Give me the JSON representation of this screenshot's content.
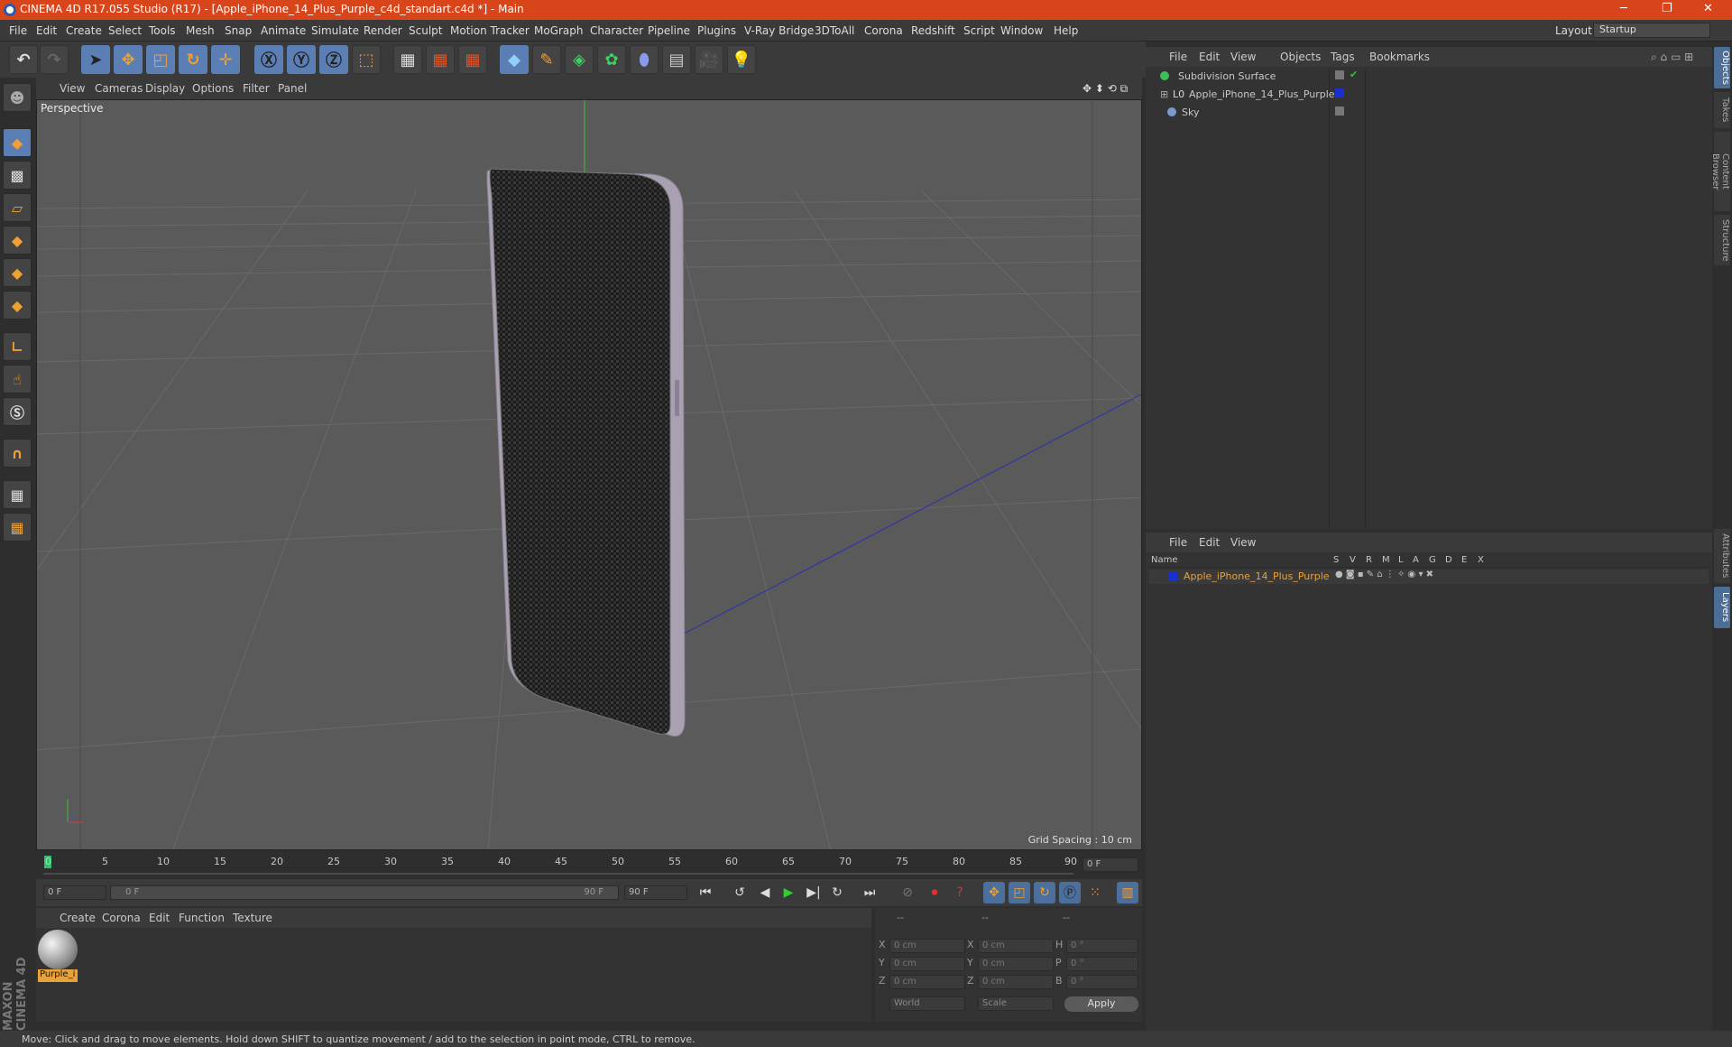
{
  "window": {
    "title": "CINEMA 4D R17.055 Studio (R17) - [Apple_iPhone_14_Plus_Purple_c4d_standart.c4d *] - Main",
    "layout_label": "Layout:",
    "layout_value": "Startup"
  },
  "menu": [
    "File",
    "Edit",
    "Create",
    "Select",
    "Tools",
    "Mesh",
    "Snap",
    "Animate",
    "Simulate",
    "Render",
    "Sculpt",
    "Motion Tracker",
    "MoGraph",
    "Character",
    "Pipeline",
    "Plugins",
    "V-Ray Bridge",
    "3DToAll",
    "Corona",
    "Redshift",
    "Script",
    "Window",
    "Help"
  ],
  "viewport": {
    "menu": [
      "View",
      "Cameras",
      "Display",
      "Options",
      "Filter",
      "Panel"
    ],
    "label": "Perspective",
    "grid_spacing": "Grid Spacing : 10 cm"
  },
  "timeline": {
    "ticks": [
      "0",
      "5",
      "10",
      "15",
      "20",
      "25",
      "30",
      "35",
      "40",
      "45",
      "50",
      "55",
      "60",
      "65",
      "70",
      "75",
      "80",
      "85",
      "90"
    ],
    "current": "0 F",
    "start": "0 F",
    "range_left": "0 F",
    "range_right": "90 F",
    "end": "90 F"
  },
  "material": {
    "menu": [
      "Create",
      "Corona",
      "Edit",
      "Function",
      "Texture"
    ],
    "swatch_label": "Purple_i"
  },
  "coords": {
    "headers": [
      "--",
      "--",
      "--"
    ],
    "rows": [
      {
        "a": "X",
        "v1": "0 cm",
        "b": "X",
        "v2": "0 cm",
        "c": "H",
        "v3": "0 °"
      },
      {
        "a": "Y",
        "v1": "0 cm",
        "b": "Y",
        "v2": "0 cm",
        "c": "P",
        "v3": "0 °"
      },
      {
        "a": "Z",
        "v1": "0 cm",
        "b": "Z",
        "v2": "0 cm",
        "c": "B",
        "v3": "0 °"
      }
    ],
    "world": "World",
    "scale": "Scale",
    "apply": "Apply"
  },
  "objects": {
    "menu": [
      "File",
      "Edit",
      "View",
      "Objects",
      "Tags",
      "Bookmarks"
    ],
    "items": [
      {
        "name": "Subdivision Surface"
      },
      {
        "name": "Apple_iPhone_14_Plus_Purple"
      },
      {
        "name": "Sky"
      }
    ]
  },
  "layers": {
    "menu": [
      "File",
      "Edit",
      "View"
    ],
    "columns": [
      "Name",
      "S",
      "V",
      "R",
      "M",
      "L",
      "A",
      "G",
      "D",
      "E",
      "X"
    ],
    "item": "Apple_iPhone_14_Plus_Purple"
  },
  "right_tabs": [
    "Objects",
    "Takes",
    "Content Browser",
    "Structure",
    "Attributes",
    "Layers"
  ],
  "status": "Move: Click and drag to move elements. Hold down SHIFT to quantize movement / add to the selection in point mode, CTRL to remove.",
  "brand": "MAXON CINEMA 4D",
  "colors": {
    "title_bar": "#d9451b",
    "accent": "#5b7fb5",
    "selected_text": "#e8a23a"
  }
}
